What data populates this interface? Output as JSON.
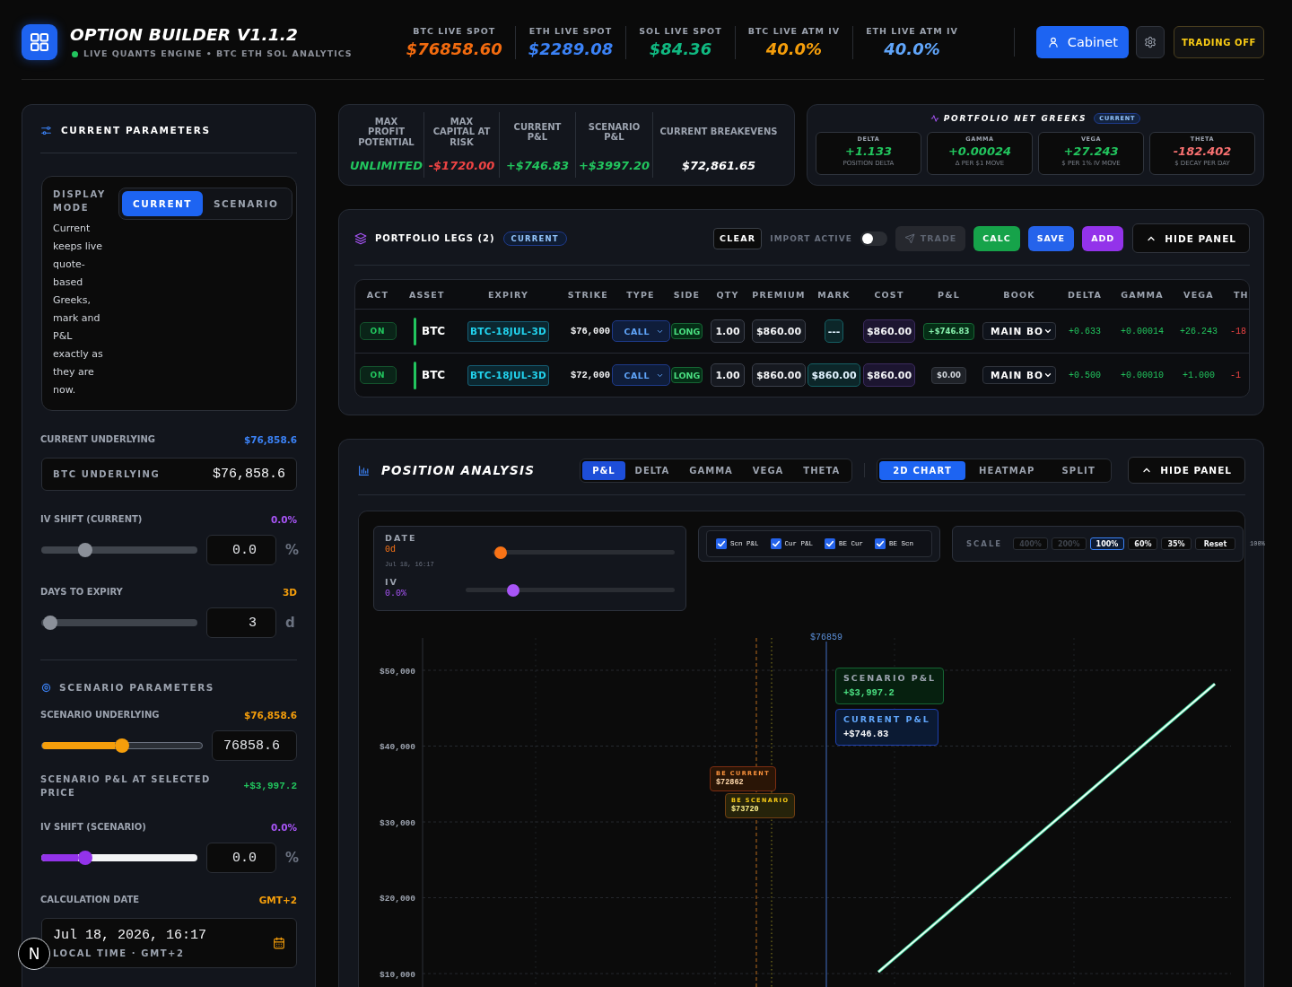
{
  "header": {
    "title": "OPTION BUILDER V1.1.2",
    "live": true,
    "subtitle": "LIVE QUANTS ENGINE • BTC ETH SOL ANALYTICS",
    "stats": [
      {
        "label": "BTC LIVE SPOT",
        "value": "$76858.60",
        "color": "#f26b0f"
      },
      {
        "label": "ETH LIVE SPOT",
        "value": "$2289.08",
        "color": "#3b82f6"
      },
      {
        "label": "SOL LIVE SPOT",
        "value": "$84.36",
        "color": "#10b981"
      },
      {
        "label": "BTC LIVE ATM IV",
        "value": "40.0%",
        "color": "#f59e0b"
      },
      {
        "label": "ETH LIVE ATM IV",
        "value": "40.0%",
        "color": "#60a5fa"
      }
    ],
    "cabinet_button": "Cabinet",
    "trading_button": "TRADING OFF"
  },
  "current_parameters": {
    "title": "CURRENT PARAMETERS",
    "display_mode": {
      "label": "DISPLAY MODE",
      "options": [
        {
          "label": "CURRENT",
          "selected": true
        },
        {
          "label": "SCENARIO",
          "selected": false
        }
      ],
      "description": "Current keeps live quote-based Greeks, mark and P&L exactly as they are now."
    },
    "current_underlying": {
      "label": "CURRENT UNDERLYING",
      "reading": "$76,858.6",
      "field_label": "BTC UNDERLYING",
      "value": "$76,858.6"
    },
    "iv_shift": {
      "label": "IV SHIFT (CURRENT)",
      "reading": "0.0%",
      "level": 0.26,
      "value": "0.0",
      "unit": "%"
    },
    "days_to_expiry": {
      "label": "DAYS TO EXPIRY",
      "reading": "3D",
      "level": 0.01,
      "value": "3",
      "unit": "d"
    }
  },
  "scenario_parameters": {
    "title": "SCENARIO PARAMETERS",
    "scenario_underlying": {
      "label": "SCENARIO UNDERLYING",
      "reading": "$76,858.6",
      "level": 0.5,
      "value": "76858.6"
    },
    "scenario_pnl": {
      "label": "SCENARIO P&L AT SELECTED PRICE",
      "value": "+$3,997.2"
    },
    "iv_shift": {
      "label": "IV SHIFT (SCENARIO)",
      "reading": "0.0%",
      "level": 0.26,
      "value": "0.0",
      "unit": "%"
    },
    "calculation_date": {
      "label": "CALCULATION DATE",
      "reading": "GMT+2",
      "value": "Jul 18, 2026, 16:17",
      "caption": "LOCAL TIME · GMT+2"
    }
  },
  "summary": [
    {
      "label": "MAX PROFIT POTENTIAL",
      "value": "UNLIMITED",
      "color": "#22c55e"
    },
    {
      "label": "MAX CAPITAL AT RISK",
      "value": "-$1720.00",
      "color": "#ef4444"
    },
    {
      "label": "CURRENT P&L",
      "value": "+$746.83",
      "color": "#22c55e"
    },
    {
      "label": "SCENARIO P&L",
      "value": "+$3997.20",
      "color": "#22c55e"
    },
    {
      "label": "CURRENT BREAKEVENS",
      "value": "$72,861.65",
      "color": "#ffffff"
    }
  ],
  "net_greeks": {
    "title": "PORTFOLIO NET GREEKS",
    "badge": "CURRENT",
    "items": [
      {
        "label": "DELTA",
        "value": "+1.133",
        "caption": "POSITION DELTA",
        "color": "#22c55e"
      },
      {
        "label": "GAMMA",
        "value": "+0.00024",
        "caption": "Δ PER $1 MOVE",
        "color": "#22c55e"
      },
      {
        "label": "VEGA",
        "value": "+27.243",
        "caption": "$ PER 1% IV MOVE",
        "color": "#22c55e"
      },
      {
        "label": "THETA",
        "value": "-182.402",
        "caption": "$ DECAY PER DAY",
        "color": "#f87171"
      }
    ]
  },
  "portfolio_legs": {
    "title": "PORTFOLIO LEGS (2)",
    "badge": "CURRENT",
    "clear_button": "CLEAR",
    "import_toggle": {
      "label": "IMPORT ACTIVE",
      "on": false
    },
    "actions": [
      {
        "label": "TRADE",
        "kind": "trade",
        "disabled": true
      },
      {
        "label": "CALC",
        "kind": "calc",
        "disabled": false
      },
      {
        "label": "SAVE",
        "kind": "save",
        "disabled": false
      },
      {
        "label": "ADD",
        "kind": "add",
        "disabled": false
      }
    ],
    "hide_button": "HIDE PANEL",
    "table": {
      "columns": [
        "ACT",
        "ASSET",
        "EXPIRY",
        "STRIKE",
        "TYPE",
        "SIDE",
        "QTY",
        "PREMIUM",
        "MARK",
        "COST",
        "P&L",
        "BOOK",
        "DELTA",
        "GAMMA",
        "VEGA",
        "TH"
      ],
      "rows": [
        {
          "act": "ON",
          "asset": "BTC",
          "expiry": "BTC-18JUL-3D",
          "strike": "$76,000",
          "type": "CALL",
          "side": "LONG",
          "qty": "1.00",
          "premium": "$860.00",
          "mark": "---",
          "cost": "$860.00",
          "pnl": "+$746.83",
          "in_profit": true,
          "book": "MAIN BO",
          "delta": "+0.633",
          "gamma": "+0.00014",
          "vega": "+26.243",
          "column_16": "-18"
        },
        {
          "act": "ON",
          "asset": "BTC",
          "expiry": "BTC-18JUL-3D",
          "strike": "$72,000",
          "type": "CALL",
          "side": "LONG",
          "qty": "1.00",
          "premium": "$860.00",
          "mark": "$860.00",
          "cost": "$860.00",
          "pnl": "$0.00",
          "in_profit": false,
          "book": "MAIN BO",
          "delta": "+0.500",
          "gamma": "+0.00010",
          "vega": "+1.000",
          "column_16": "-1"
        }
      ]
    }
  },
  "position_analysis": {
    "title": "POSITION ANALYSIS",
    "metric_tabs": [
      {
        "label": "P&L",
        "selected": true
      },
      {
        "label": "DELTA",
        "selected": false
      },
      {
        "label": "GAMMA",
        "selected": false
      },
      {
        "label": "VEGA",
        "selected": false
      },
      {
        "label": "THETA",
        "selected": false
      }
    ],
    "view_tabs": [
      {
        "label": "2D CHART",
        "selected": true
      },
      {
        "label": "HEATMAP",
        "selected": false
      },
      {
        "label": "SPLIT",
        "selected": false
      }
    ],
    "hide_button": "HIDE PANEL",
    "date_control": {
      "label": "DATE",
      "reading": "0d",
      "caption": "Jul 18, 16:17",
      "level": 0.01
    },
    "iv_control": {
      "label": "IV",
      "reading": "0.0%",
      "level": 0.21
    },
    "series_toggles": [
      {
        "label": "Scn P&L",
        "checked": true
      },
      {
        "label": "Cur P&L",
        "checked": true
      },
      {
        "label": "BE Cur",
        "checked": true
      },
      {
        "label": "BE Scn",
        "checked": true
      }
    ],
    "scale": {
      "label": "SCALE",
      "options": [
        {
          "label": "400%",
          "selected": false,
          "disabled": true
        },
        {
          "label": "200%",
          "selected": false,
          "disabled": true
        },
        {
          "label": "100%",
          "selected": true,
          "disabled": false
        },
        {
          "label": "60%",
          "selected": false,
          "disabled": false
        },
        {
          "label": "35%",
          "selected": false,
          "disabled": false
        }
      ],
      "reset": "Reset",
      "readout": "100%"
    },
    "spot_label": "$76859",
    "breakeven_tags": [
      {
        "kind": "current",
        "title": "BE CURRENT",
        "value": "$72862"
      },
      {
        "kind": "scenario",
        "title": "BE SCENARIO",
        "value": "$73720"
      }
    ],
    "readouts": [
      {
        "kind": "scenario",
        "title": "SCENARIO P&L",
        "value": "+$3,997.2"
      },
      {
        "kind": "current",
        "title": "CURRENT P&L",
        "value": "+$746.83"
      }
    ],
    "chart_data": {
      "type": "line",
      "grid": true,
      "categories": [
        null,
        null,
        null,
        null,
        null,
        null,
        null,
        null,
        null,
        null,
        null,
        null
      ],
      "ylim": [
        8300,
        54000
      ],
      "yticks": [
        {
          "value": 10000,
          "label": "$10,000"
        },
        {
          "value": 20000,
          "label": "$20,000"
        },
        {
          "value": 30000,
          "label": "$30,000"
        },
        {
          "value": 40000,
          "label": "$40,000"
        },
        {
          "value": 50000,
          "label": "$50,000"
        }
      ],
      "series": [
        {
          "color": "#34d399",
          "values": [
            null,
            null,
            null,
            null,
            null,
            null,
            10200,
            17800,
            25400,
            33000,
            40600,
            48200
          ]
        },
        {
          "color": "#f0fdf4",
          "values": [
            null,
            null,
            null,
            null,
            null,
            null,
            10200,
            17800,
            25400,
            33000,
            40600,
            48200
          ]
        }
      ]
    }
  },
  "dev_badge": "N"
}
